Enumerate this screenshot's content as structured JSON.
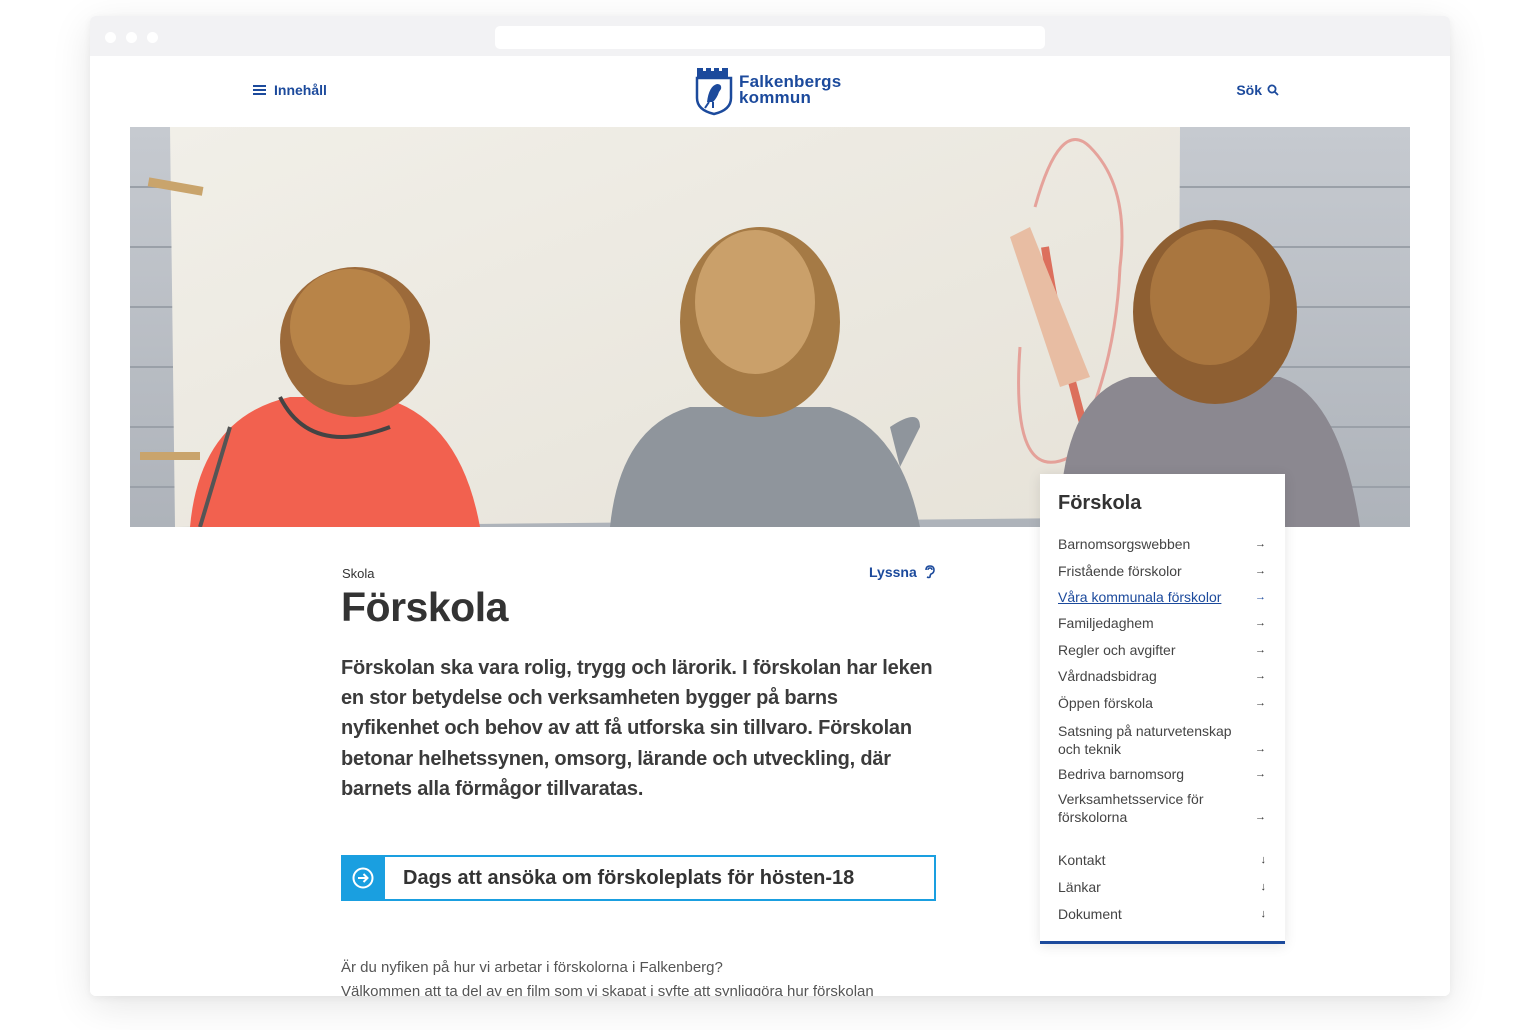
{
  "header": {
    "menu_label": "Innehåll",
    "logo_line1": "Falkenbergs",
    "logo_line2": "kommun",
    "search_label": "Sök"
  },
  "page": {
    "breadcrumb": "Skola",
    "listen_label": "Lyssna",
    "title": "Förskola",
    "lead": "Förskolan ska vara rolig, trygg och lärorik. I förskolan har leken en stor betydelse och verksamheten bygger på barns nyfikenhet och behov av att få utforska sin tillvaro. Förskolan betonar helhetssynen, omsorg, lärande och utveckling, där barnets alla förmågor tillvaratas.",
    "cta_label": "Dags att ansöka om förskoleplats för hösten-18",
    "body_line1": "Är du nyfiken på hur vi arbetar i förskolorna i Falkenberg?",
    "body_line2": "Välkommen att ta del av en film som vi skapat i syfte att synliggöra hur förskolan"
  },
  "sidenav": {
    "title": "Förskola",
    "items": [
      {
        "label": "Barnomsorgswebben",
        "arrow": "→"
      },
      {
        "label": "Fristående förskolor",
        "arrow": "→"
      },
      {
        "label": "Våra kommunala förskolor",
        "arrow": "→"
      },
      {
        "label": "Familjedaghem",
        "arrow": "→"
      },
      {
        "label": "Regler och avgifter",
        "arrow": "→"
      },
      {
        "label": "Vårdnadsbidrag",
        "arrow": "→"
      },
      {
        "label": "Öppen förskola",
        "arrow": "→"
      },
      {
        "label": "Satsning på naturvetenskap och teknik",
        "arrow": "→"
      },
      {
        "label": "Bedriva barnomsorg",
        "arrow": "→"
      },
      {
        "label": "Verksamhetsservice för förskolorna",
        "arrow": "→"
      },
      {
        "label": "Kontakt",
        "arrow": "↓"
      },
      {
        "label": "Länkar",
        "arrow": "↓"
      },
      {
        "label": "Dokument",
        "arrow": "↓"
      }
    ]
  },
  "colors": {
    "brand_blue": "#1c4a9c",
    "cta_blue": "#1a9fe0",
    "text_dark": "#333333"
  }
}
